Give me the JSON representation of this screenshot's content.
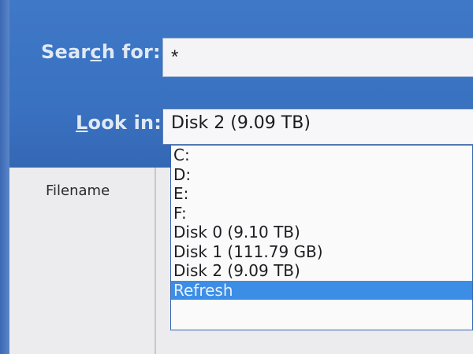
{
  "search_panel": {
    "search_label": {
      "pre": "Sear",
      "accel": "c",
      "post": "h for:"
    },
    "search_value": "*",
    "lookin_label": {
      "accel": "L",
      "post": "ook in:"
    },
    "lookin_value": "Disk 2 (9.09 TB)"
  },
  "results": {
    "column_header": "Filename"
  },
  "dropdown": {
    "items": [
      {
        "label": "C:"
      },
      {
        "label": "D:"
      },
      {
        "label": "E:"
      },
      {
        "label": "F:"
      },
      {
        "label": "Disk 0 (9.10 TB)"
      },
      {
        "label": "Disk 1 (111.79 GB)"
      },
      {
        "label": "Disk 2 (9.09 TB)"
      },
      {
        "label": "Refresh"
      }
    ],
    "highlighted_index": 7
  },
  "colors": {
    "panel_blue": "#3a72c2",
    "highlight_blue": "#3c8de6"
  }
}
